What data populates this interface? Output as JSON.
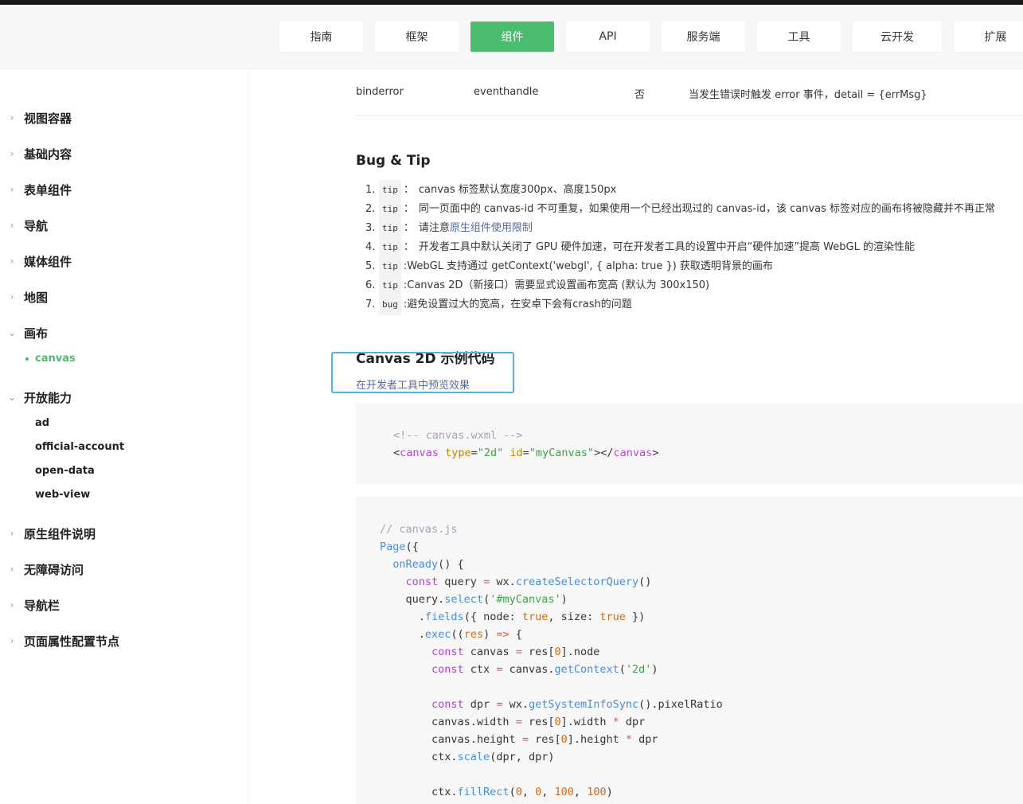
{
  "nav": {
    "tabs": [
      {
        "label": "指南",
        "active": false
      },
      {
        "label": "框架",
        "active": false
      },
      {
        "label": "组件",
        "active": true
      },
      {
        "label": "API",
        "active": false
      },
      {
        "label": "服务端",
        "active": false
      },
      {
        "label": "工具",
        "active": false
      },
      {
        "label": "云开发",
        "active": false
      },
      {
        "label": "扩展",
        "active": false
      }
    ],
    "accent_color": "#4bbc6e"
  },
  "sidebar": {
    "groups": [
      {
        "label": "视图容器",
        "expanded": false
      },
      {
        "label": "基础内容",
        "expanded": false
      },
      {
        "label": "表单组件",
        "expanded": false
      },
      {
        "label": "导航",
        "expanded": false
      },
      {
        "label": "媒体组件",
        "expanded": false
      },
      {
        "label": "地图",
        "expanded": false
      },
      {
        "label": "画布",
        "expanded": true
      },
      {
        "label": "开放能力",
        "expanded": true
      },
      {
        "label": "原生组件说明",
        "expanded": false
      },
      {
        "label": "无障碍访问",
        "expanded": false
      },
      {
        "label": "导航栏",
        "expanded": false
      },
      {
        "label": "页面属性配置节点",
        "expanded": false
      }
    ],
    "canvas_item": "canvas",
    "open_items": [
      "ad",
      "official-account",
      "open-data",
      "web-view"
    ]
  },
  "table_row": {
    "name": "binderror",
    "type": "eventhandle",
    "required": "否",
    "desc": "当发生错误时触发 error 事件，detail = {errMsg}"
  },
  "bugtip": {
    "title": "Bug & Tip",
    "items": [
      {
        "num": "1.",
        "tag": "tip",
        "sep": "：",
        "text": "canvas 标签默认宽度300px、高度150px",
        "link": ""
      },
      {
        "num": "2.",
        "tag": "tip",
        "sep": "：",
        "text": "同一页面中的 canvas-id 不可重复，如果使用一个已经出现过的 canvas-id，该 canvas 标签对应的画布将被隐藏并不再正常",
        "link": ""
      },
      {
        "num": "3.",
        "tag": "tip",
        "sep": "：",
        "text": "请注意",
        "link": "原生组件使用限制"
      },
      {
        "num": "4.",
        "tag": "tip",
        "sep": "：",
        "text": "开发者工具中默认关闭了 GPU 硬件加速，可在开发者工具的设置中开启“硬件加速”提高 WebGL 的渲染性能",
        "link": ""
      },
      {
        "num": "5.",
        "tag": "tip",
        "sep": ":",
        "text": "WebGL 支持通过 getContext('webgl', { alpha: true }) 获取透明背景的画布",
        "link": ""
      },
      {
        "num": "6.",
        "tag": "tip",
        "sep": ":",
        "text": "Canvas 2D（新接口）需要显式设置画布宽高 (默认为 300x150)",
        "link": ""
      },
      {
        "num": "7.",
        "tag": "bug",
        "sep": ":",
        "text": "避免设置过大的宽高，在安卓下会有crash的问题",
        "link": ""
      }
    ]
  },
  "example": {
    "title": "Canvas 2D 示例代码",
    "preview_link": "在开发者工具中预览效果"
  }
}
